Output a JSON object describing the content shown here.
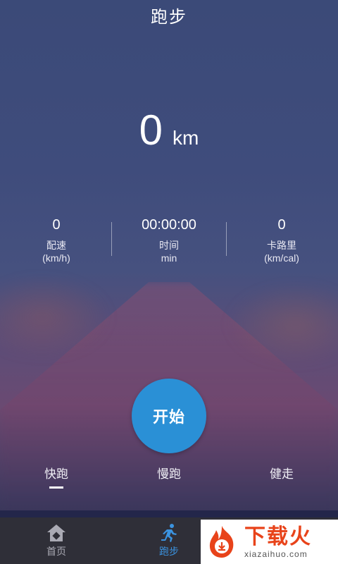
{
  "header": {
    "title": "跑步"
  },
  "distance": {
    "value": "0",
    "unit": "km"
  },
  "stats": [
    {
      "value": "0",
      "label": "配速",
      "unit": "(km/h)"
    },
    {
      "value": "00:00:00",
      "label": "时间",
      "unit": "min"
    },
    {
      "value": "0",
      "label": "卡路里",
      "unit": "(km/cal)"
    }
  ],
  "start_button": {
    "label": "开始"
  },
  "modes": [
    {
      "label": "快跑",
      "active": true
    },
    {
      "label": "慢跑",
      "active": false
    },
    {
      "label": "健走",
      "active": false
    }
  ],
  "tabbar": {
    "items": [
      {
        "label": "首页",
        "icon": "home-icon"
      },
      {
        "label": "跑步",
        "icon": "runner-icon",
        "active": true
      }
    ]
  },
  "watermark": {
    "main": "下载火",
    "sub": "xiazaihuo.com"
  },
  "colors": {
    "accent": "#2a90d6",
    "active_tab": "#3b93e0",
    "tabbar_bg": "#2f2f38"
  }
}
